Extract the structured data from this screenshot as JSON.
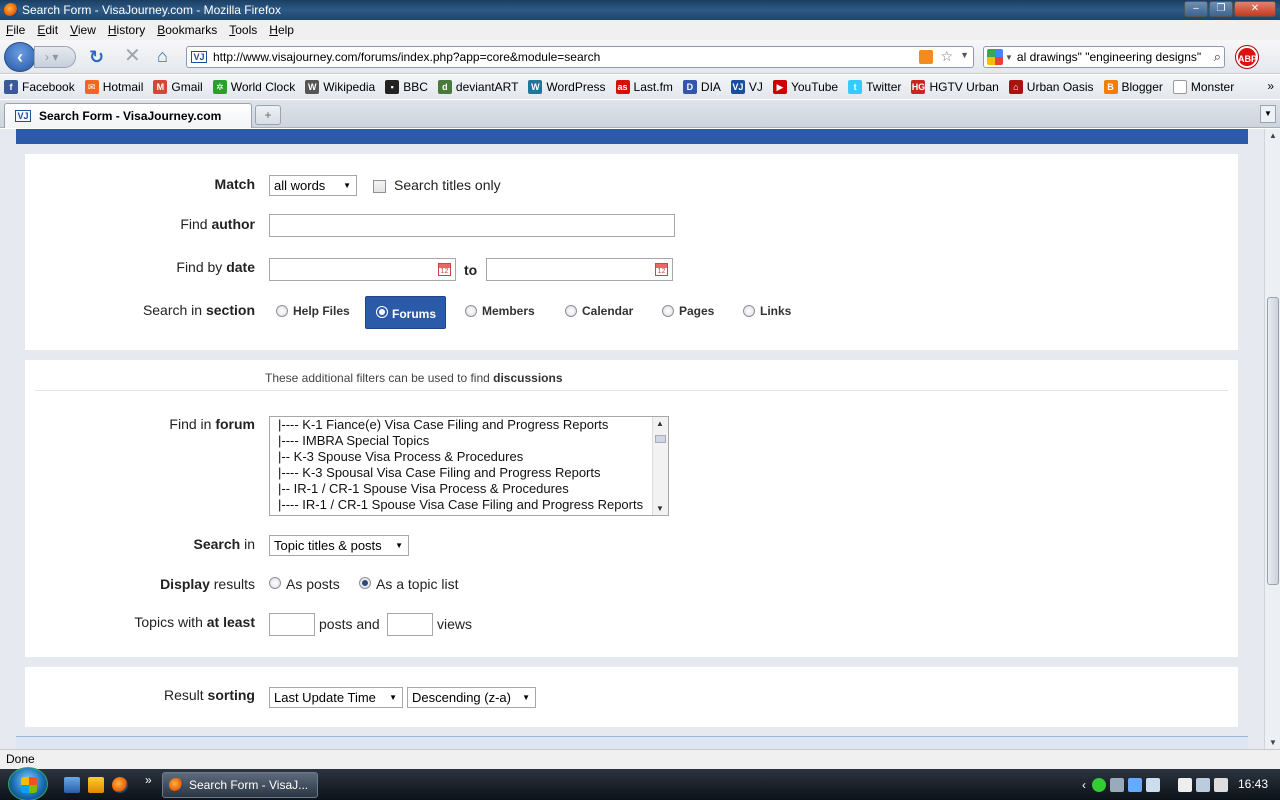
{
  "window": {
    "title": "Search Form - VisaJourney.com - Mozilla Firefox"
  },
  "menubar": [
    "File",
    "Edit",
    "View",
    "History",
    "Bookmarks",
    "Tools",
    "Help"
  ],
  "navbar": {
    "url": "http://www.visajourney.com/forums/index.php?app=core&module=search",
    "search_query": "al drawings\" \"engineering designs\"",
    "abp_label": "ABP"
  },
  "bookmarks": [
    {
      "label": "Facebook",
      "color": "#3b5998",
      "glyph": "f"
    },
    {
      "label": "Hotmail",
      "color": "#f26522",
      "glyph": "✉"
    },
    {
      "label": "Gmail",
      "color": "#d14836",
      "glyph": "M"
    },
    {
      "label": "World Clock",
      "color": "#2aa02a",
      "glyph": "✲"
    },
    {
      "label": "Wikipedia",
      "color": "#555555",
      "glyph": "W"
    },
    {
      "label": "BBC",
      "color": "#222222",
      "glyph": "▪"
    },
    {
      "label": "deviantART",
      "color": "#4a7a3a",
      "glyph": "d"
    },
    {
      "label": "WordPress",
      "color": "#21759b",
      "glyph": "W"
    },
    {
      "label": "Last.fm",
      "color": "#d51007",
      "glyph": "as"
    },
    {
      "label": "DIA",
      "color": "#3355aa",
      "glyph": "D"
    },
    {
      "label": "VJ",
      "color": "#1a4f9c",
      "glyph": "VJ"
    },
    {
      "label": "YouTube",
      "color": "#cc0000",
      "glyph": "▶"
    },
    {
      "label": "Twitter",
      "color": "#33ccff",
      "glyph": "t"
    },
    {
      "label": "HGTV Urban",
      "color": "#cc2222",
      "glyph": "HG"
    },
    {
      "label": "Urban Oasis",
      "color": "#aa1111",
      "glyph": "⌂"
    },
    {
      "label": "Blogger",
      "color": "#f57d00",
      "glyph": "B"
    },
    {
      "label": "Monster",
      "color": "#ffffff",
      "glyph": ""
    }
  ],
  "bookmarks_more": "»",
  "tab": {
    "label": "Search Form - VisaJourney.com",
    "new_tab": "+"
  },
  "form": {
    "match": {
      "label": "Match",
      "value": "all words",
      "checkbox_label": "Search titles only"
    },
    "author": {
      "label_pre": "Find ",
      "label_b": "author"
    },
    "date": {
      "label_pre": "Find by ",
      "label_b": "date",
      "to": "to"
    },
    "section": {
      "label_pre": "Search in ",
      "label_b": "section",
      "options": [
        "Help Files",
        "Forums",
        "Members",
        "Calendar",
        "Pages",
        "Links"
      ],
      "selected": "Forums"
    },
    "hint_pre": "These additional filters can be used to find ",
    "hint_b": "discussions",
    "forum": {
      "label_pre": "Find in ",
      "label_b": "forum",
      "options": [
        "|---- K-1 Fiance(e) Visa Case Filing and Progress Reports",
        "|---- IMBRA Special Topics",
        "|-- K-3 Spouse Visa Process & Procedures",
        "|---- K-3 Spousal Visa Case Filing and Progress Reports",
        "|-- IR-1 / CR-1 Spouse Visa Process & Procedures",
        "|---- IR-1 / CR-1 Spouse Visa Case Filing and Progress Reports"
      ]
    },
    "search_in": {
      "label_b": "Search",
      "label_post": " in",
      "value": "Topic titles & posts"
    },
    "display": {
      "label_b": "Display",
      "label_post": " results",
      "as_posts": "As posts",
      "as_list": "As a topic list"
    },
    "at_least": {
      "label_pre": "Topics with ",
      "label_b": "at least",
      "posts_and": "posts and",
      "views": "views"
    },
    "sorting": {
      "label_pre": "Result ",
      "label_b": "sorting",
      "field": "Last Update Time",
      "order": "Descending (z-a)"
    }
  },
  "status": "Done",
  "taskbar": {
    "task_label": "Search Form - VisaJ...",
    "clock": "16:43",
    "tray_arrow": "‹",
    "ql_more": "»"
  },
  "colors": {
    "accent": "#2a5aa8",
    "page_bg": "#e6e9ef"
  }
}
